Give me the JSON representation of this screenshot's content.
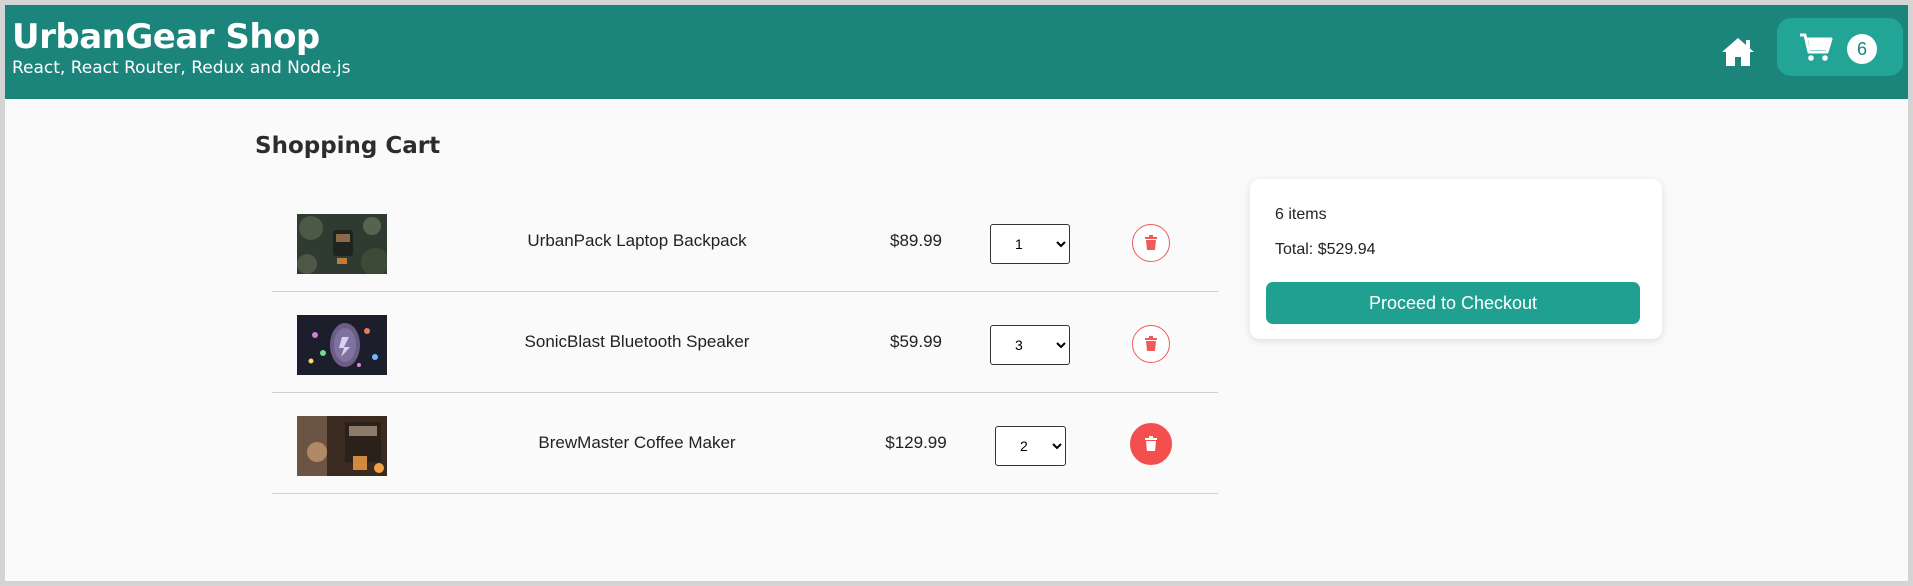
{
  "header": {
    "title": "UrbanGear Shop",
    "subtitle": "React, React Router, Redux and Node.js",
    "cart_count": "6",
    "brand_color": "#1b857c",
    "cart_button_color": "#22a597",
    "icons": [
      "home-icon",
      "cart-icon"
    ]
  },
  "cart": {
    "title": "Shopping Cart",
    "items": [
      {
        "name": "UrbanPack Laptop Backpack",
        "price": "$89.99",
        "quantity": "1",
        "image": "backpack-photo"
      },
      {
        "name": "SonicBlast Bluetooth Speaker",
        "price": "$59.99",
        "quantity": "3",
        "image": "speaker-photo"
      },
      {
        "name": "BrewMaster Coffee Maker",
        "price": "$129.99",
        "quantity": "2",
        "image": "coffee-maker-photo"
      }
    ],
    "delete_color": "#f44f4f"
  },
  "summary": {
    "items_text": "6 items",
    "total_text": "Total: $529.94",
    "checkout_label": "Proceed to Checkout",
    "button_color": "#20a090"
  }
}
